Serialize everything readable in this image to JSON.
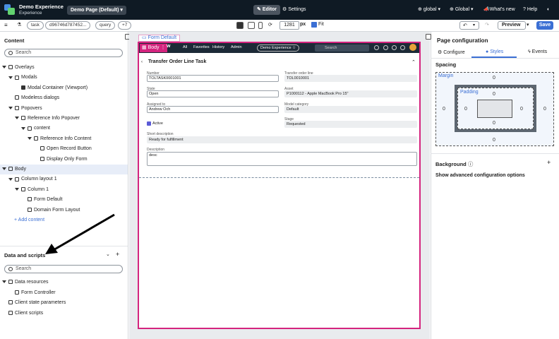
{
  "app": {
    "name": "Demo Experience",
    "subtitle": "Experience"
  },
  "topbar": {
    "page_selector": "Demo Page (Default)",
    "editor_label": "Editor",
    "settings_label": "Settings",
    "scope_label": "global",
    "global_label": "Global",
    "whats_new_label": "What's new",
    "help_label": "Help"
  },
  "toolbar": {
    "pills": [
      "task",
      "d96746d787452...",
      "query",
      "+7"
    ],
    "width_value": "1281",
    "width_unit": "px",
    "fit_label": "Fit",
    "preview_label": "Preview",
    "save_label": "Save"
  },
  "content_panel": {
    "title": "Content",
    "search_placeholder": "Search",
    "tree": [
      {
        "label": "Overlays",
        "level": 0,
        "expand": true,
        "icon": "overlay-icon"
      },
      {
        "label": "Modals",
        "level": 1,
        "expand": true,
        "icon": "modal-icon"
      },
      {
        "label": "Modal Container (Viewport)",
        "level": 2,
        "expand": false,
        "icon": "container-icon"
      },
      {
        "label": "Modeless dialogs",
        "level": 1,
        "expand": false,
        "icon": "dialog-icon"
      },
      {
        "label": "Popovers",
        "level": 1,
        "expand": true,
        "icon": "popover-icon"
      },
      {
        "label": "Reference Info Popover",
        "level": 2,
        "expand": true,
        "icon": "popover-icon"
      },
      {
        "label": "content",
        "level": 3,
        "expand": true,
        "icon": "container-icon"
      },
      {
        "label": "Reference Info Content",
        "level": 4,
        "expand": true,
        "icon": "container-icon"
      },
      {
        "label": "Open Record Button",
        "level": 5,
        "expand": false,
        "icon": "button-icon"
      },
      {
        "label": "Display Only Form",
        "level": 5,
        "expand": false,
        "icon": "form-icon"
      },
      {
        "label": "Body",
        "level": 0,
        "expand": true,
        "icon": "body-icon",
        "selected": true
      },
      {
        "label": "Column layout 1",
        "level": 1,
        "expand": true,
        "icon": "columns-icon"
      },
      {
        "label": "Column 1",
        "level": 2,
        "expand": true,
        "icon": "column-icon"
      },
      {
        "label": "Form Default",
        "level": 3,
        "expand": false,
        "icon": "form-icon"
      },
      {
        "label": "Domain Form Layout",
        "level": 3,
        "expand": false,
        "icon": "layout-icon"
      }
    ],
    "add_content": "+ Add content"
  },
  "data_panel": {
    "title": "Data and scripts",
    "search_placeholder": "Search",
    "tree": [
      {
        "label": "Data resources",
        "level": 0,
        "expand": true,
        "icon": "database-icon"
      },
      {
        "label": "Form Controller",
        "level": 1,
        "expand": false,
        "icon": "database-icon"
      },
      {
        "label": "Client state parameters",
        "level": 0,
        "expand": false,
        "icon": "params-icon"
      },
      {
        "label": "Client scripts",
        "level": 0,
        "expand": false,
        "icon": "code-icon"
      }
    ]
  },
  "canvas": {
    "tab_label": "Form Default",
    "body_tag": "Body",
    "nav_items": [
      "All",
      "Favorites",
      "History",
      "Admin"
    ],
    "demo_pill": "Demo Experience ☆",
    "search_placeholder": "Search",
    "form": {
      "title": "Transfer Order Line Task",
      "fields": [
        {
          "label": "Number",
          "value": "TOLTASK0001001",
          "readonly": false
        },
        {
          "label": "Transfer order line",
          "value": "TOL0010001",
          "readonly": true
        },
        {
          "label": "State",
          "value": "Open",
          "readonly": false
        },
        {
          "label": "Asset",
          "value": "P1000112 - Apple MacBook Pro 15\"",
          "readonly": true
        },
        {
          "label": "Assigned to",
          "value": "Andrew Och",
          "readonly": false
        },
        {
          "label": "Model category",
          "value": "Default",
          "readonly": true
        },
        {
          "label": "Stage",
          "value": "Requested",
          "readonly": true
        }
      ],
      "active_label": "Active",
      "short_desc_label": "Short description",
      "short_desc_value": "Ready for fulfillment",
      "description_label": "Description",
      "description_value": "desc"
    }
  },
  "page_config": {
    "title": "Page configuration",
    "tabs": [
      "Configure",
      "Styles",
      "Events"
    ],
    "active_tab": "Styles",
    "spacing_title": "Spacing",
    "margin_label": "Margin",
    "padding_label": "Padding",
    "margin": {
      "top": "0",
      "right": "0",
      "bottom": "0",
      "left": "0"
    },
    "padding": {
      "top": "0",
      "right": "0",
      "bottom": "0",
      "left": "0"
    },
    "background_title": "Background",
    "advanced_link": "Show advanced configuration options"
  },
  "colors": {
    "accent": "#3b6fd4",
    "selection": "#d4247e",
    "topbar": "#0f1a24"
  }
}
